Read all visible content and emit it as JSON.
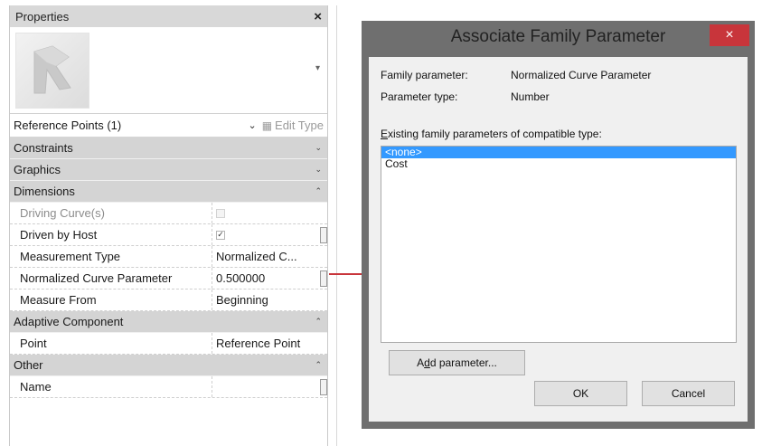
{
  "properties": {
    "title": "Properties",
    "close_glyph": "×",
    "type_selector": "Reference Points (1)",
    "edit_type_label": "Edit Type",
    "groups": {
      "constraints": "Constraints",
      "graphics": "Graphics",
      "dimensions": "Dimensions",
      "adaptive": "Adaptive Component",
      "other": "Other"
    },
    "rows": {
      "driving_curve": {
        "name": "Driving Curve(s)",
        "checked": false,
        "enabled": false
      },
      "driven_by_host": {
        "name": "Driven by Host",
        "checked": true
      },
      "measurement_type": {
        "name": "Measurement Type",
        "value": "Normalized C..."
      },
      "normalized_curve_param": {
        "name": "Normalized Curve Parameter",
        "value": "0.500000"
      },
      "measure_from": {
        "name": "Measure From",
        "value": "Beginning"
      },
      "point": {
        "name": "Point",
        "value": "Reference Point"
      },
      "name_row": {
        "name": "Name",
        "value": ""
      }
    }
  },
  "dialog": {
    "title": "Associate Family Parameter",
    "close_glyph": "×",
    "family_parameter_label": "Family parameter:",
    "family_parameter_value": "Normalized Curve Parameter",
    "parameter_type_label": "Parameter type:",
    "parameter_type_value": "Number",
    "existing_label_access": "E",
    "existing_label_rest": "xisting family parameters of compatible type:",
    "list_items": [
      "<none>",
      "Cost"
    ],
    "selected_index": 0,
    "add_parameter_prefix": "A",
    "add_parameter_access": "d",
    "add_parameter_rest": "d parameter...",
    "ok_label": "OK",
    "cancel_label": "Cancel"
  },
  "colors": {
    "arrow": "#c8353b",
    "dialog_close": "#c8353b",
    "selection": "#3399ff",
    "group_header": "#d4d4d4"
  }
}
